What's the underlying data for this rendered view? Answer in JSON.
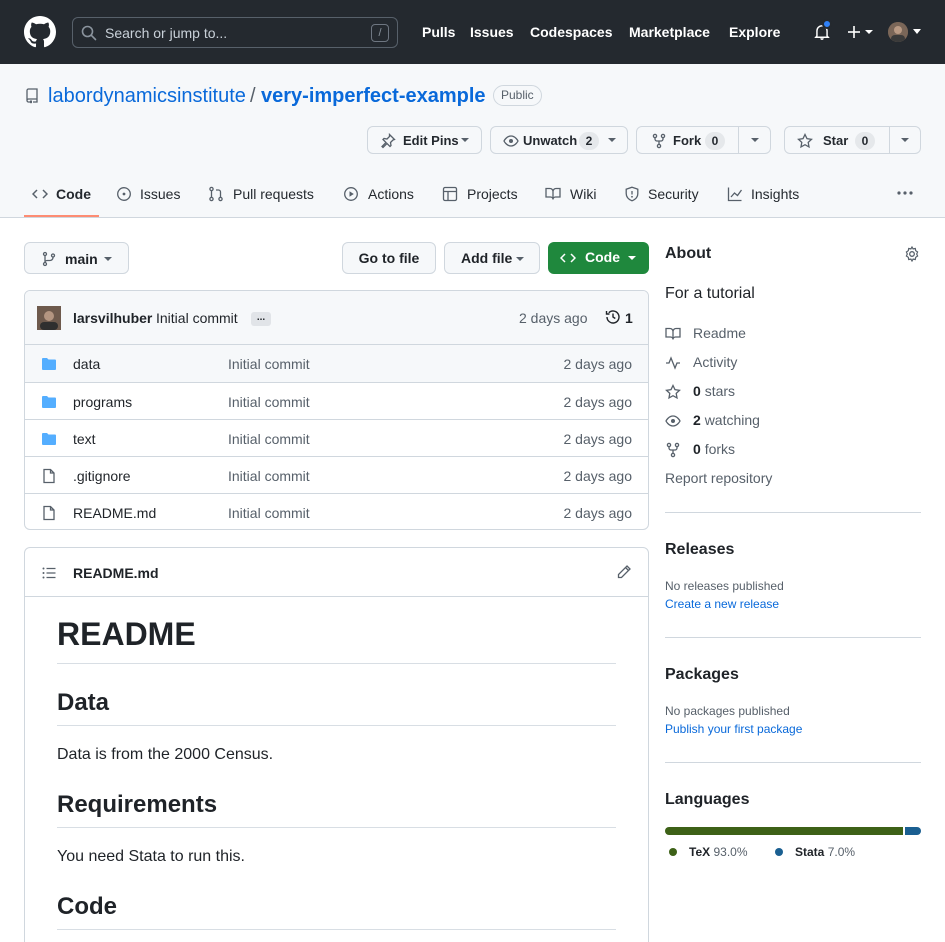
{
  "header": {
    "search_placeholder": "Search or jump to...",
    "search_shortcut": "/",
    "nav": [
      "Pulls",
      "Issues",
      "Codespaces",
      "Marketplace",
      "Explore"
    ]
  },
  "repo": {
    "owner": "labordynamicsinstitute",
    "separator": "/",
    "name": "very-imperfect-example",
    "visibility": "Public",
    "actions": {
      "edit_pins": "Edit Pins",
      "unwatch": "Unwatch",
      "watch_count": "2",
      "fork": "Fork",
      "fork_count": "0",
      "star": "Star",
      "star_count": "0"
    }
  },
  "tabs": [
    "Code",
    "Issues",
    "Pull requests",
    "Actions",
    "Projects",
    "Wiki",
    "Security",
    "Insights"
  ],
  "toolbar": {
    "branch": "main",
    "go_to_file": "Go to file",
    "add_file": "Add file",
    "code": "Code"
  },
  "commit": {
    "user": "larsvilhuber",
    "message": "Initial commit",
    "dots": "...",
    "time": "2 days ago",
    "count": "1"
  },
  "files": [
    {
      "name": "data",
      "type": "folder",
      "commit": "Initial commit",
      "time": "2 days ago"
    },
    {
      "name": "programs",
      "type": "folder",
      "commit": "Initial commit",
      "time": "2 days ago"
    },
    {
      "name": "text",
      "type": "folder",
      "commit": "Initial commit",
      "time": "2 days ago"
    },
    {
      "name": ".gitignore",
      "type": "file",
      "commit": "Initial commit",
      "time": "2 days ago"
    },
    {
      "name": "README.md",
      "type": "file",
      "commit": "Initial commit",
      "time": "2 days ago"
    }
  ],
  "readme": {
    "title": "README.md",
    "h1": "README",
    "sections": [
      {
        "heading": "Data",
        "text": "Data is from the 2000 Census."
      },
      {
        "heading": "Requirements",
        "text": "You need Stata to run this."
      },
      {
        "heading": "Code",
        "text": ""
      }
    ]
  },
  "about": {
    "title": "About",
    "description": "For a tutorial",
    "readme": "Readme",
    "activity": "Activity",
    "stars_count": "0",
    "stars_label": "stars",
    "watching_count": "2",
    "watching_label": "watching",
    "forks_count": "0",
    "forks_label": "forks",
    "report": "Report repository"
  },
  "releases": {
    "title": "Releases",
    "empty": "No releases published",
    "link": "Create a new release"
  },
  "packages": {
    "title": "Packages",
    "empty": "No packages published",
    "link": "Publish your first package"
  },
  "languages": {
    "title": "Languages",
    "items": [
      {
        "name": "TeX",
        "percent": "93.0%",
        "value": 93.0,
        "color": "#3D6117"
      },
      {
        "name": "Stata",
        "percent": "7.0%",
        "value": 7.0,
        "color": "#1A5F91"
      }
    ]
  }
}
